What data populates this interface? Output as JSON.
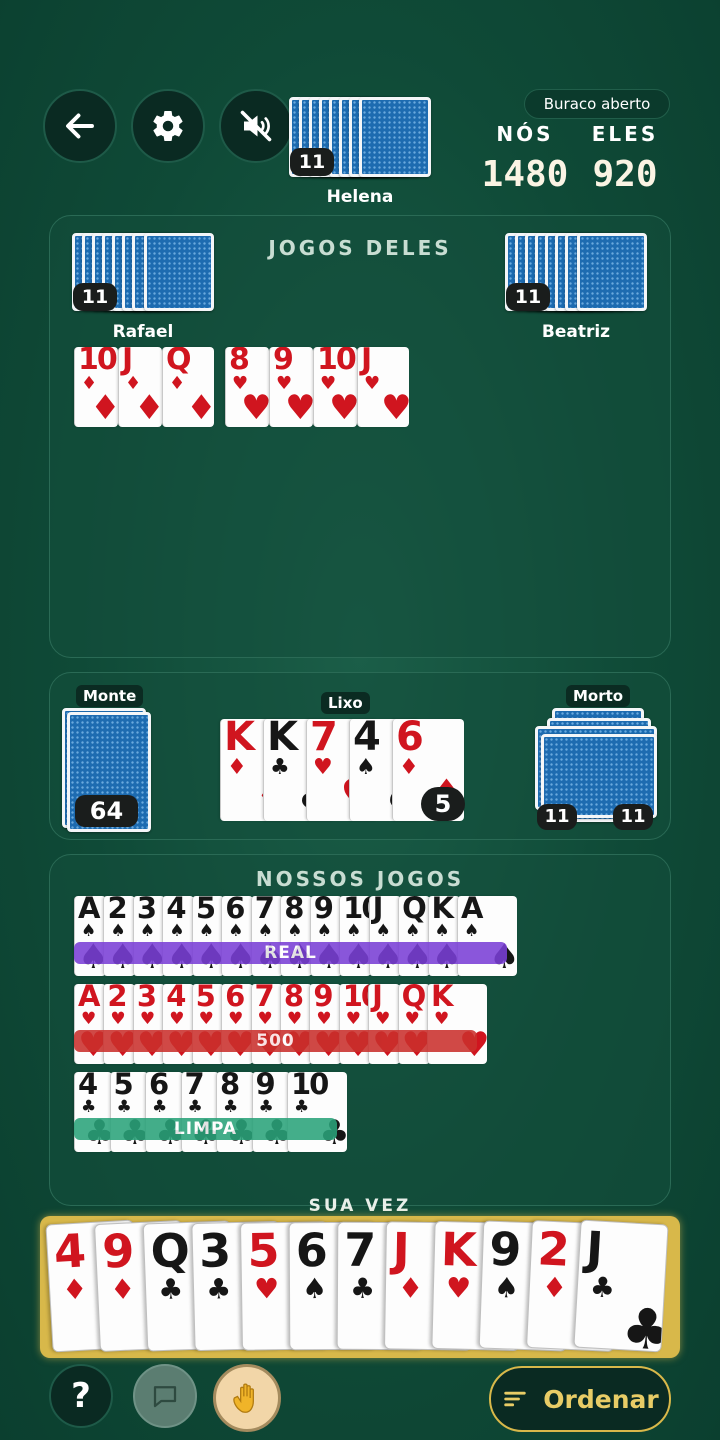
{
  "top": {
    "back_icon": "arrow-left-icon",
    "settings_icon": "gear-icon",
    "sound_icon": "speaker-muted-icon",
    "opponent_top": {
      "name": "Helena",
      "count": "11"
    }
  },
  "score": {
    "mode": "Buraco aberto",
    "us_label": "NÓS",
    "them_label": "ELES",
    "us_value": "1480",
    "them_value": "920"
  },
  "their_games": {
    "title": "JOGOS DELES",
    "left_player": {
      "name": "Rafael",
      "count": "11"
    },
    "right_player": {
      "name": "Beatriz",
      "count": "11"
    },
    "melds": [
      {
        "cards": [
          {
            "r": "10",
            "s": "♦",
            "c": "red"
          },
          {
            "r": "J",
            "s": "♦",
            "c": "red"
          },
          {
            "r": "Q",
            "s": "♦",
            "c": "red"
          }
        ]
      },
      {
        "cards": [
          {
            "r": "8",
            "s": "♥",
            "c": "red"
          },
          {
            "r": "9",
            "s": "♥",
            "c": "red"
          },
          {
            "r": "10",
            "s": "♥",
            "c": "red"
          },
          {
            "r": "J",
            "s": "♥",
            "c": "red"
          }
        ]
      }
    ]
  },
  "table": {
    "stock_label": "Monte",
    "stock_count": "64",
    "discard_label": "Lixo",
    "discard_count": "5",
    "discard_cards": [
      {
        "r": "K",
        "s": "♦",
        "c": "red"
      },
      {
        "r": "K",
        "s": "♣",
        "c": "blk"
      },
      {
        "r": "7",
        "s": "♥",
        "c": "red"
      },
      {
        "r": "4",
        "s": "♠",
        "c": "blk"
      },
      {
        "r": "6",
        "s": "♦",
        "c": "red"
      }
    ],
    "dead_label": "Morto",
    "dead_counts": [
      "11",
      "11"
    ]
  },
  "our_games": {
    "title": "NOSSOS JOGOS",
    "melds": [
      {
        "label": "REAL",
        "band_color": "#7a3fd6",
        "cards": [
          {
            "r": "A",
            "s": "♠",
            "c": "blk"
          },
          {
            "r": "2",
            "s": "♠",
            "c": "blk"
          },
          {
            "r": "3",
            "s": "♠",
            "c": "blk"
          },
          {
            "r": "4",
            "s": "♠",
            "c": "blk"
          },
          {
            "r": "5",
            "s": "♠",
            "c": "blk"
          },
          {
            "r": "6",
            "s": "♠",
            "c": "blk"
          },
          {
            "r": "7",
            "s": "♠",
            "c": "blk"
          },
          {
            "r": "8",
            "s": "♠",
            "c": "blk"
          },
          {
            "r": "9",
            "s": "♠",
            "c": "blk"
          },
          {
            "r": "10",
            "s": "♠",
            "c": "blk"
          },
          {
            "r": "J",
            "s": "♠",
            "c": "blk"
          },
          {
            "r": "Q",
            "s": "♠",
            "c": "blk"
          },
          {
            "r": "K",
            "s": "♠",
            "c": "blk"
          },
          {
            "r": "A",
            "s": "♠",
            "c": "blk"
          }
        ]
      },
      {
        "label": "500",
        "band_color": "#c9302c",
        "cards": [
          {
            "r": "A",
            "s": "♥",
            "c": "red"
          },
          {
            "r": "2",
            "s": "♥",
            "c": "red"
          },
          {
            "r": "3",
            "s": "♥",
            "c": "red"
          },
          {
            "r": "4",
            "s": "♥",
            "c": "red"
          },
          {
            "r": "5",
            "s": "♥",
            "c": "red"
          },
          {
            "r": "6",
            "s": "♥",
            "c": "red"
          },
          {
            "r": "7",
            "s": "♥",
            "c": "red"
          },
          {
            "r": "8",
            "s": "♥",
            "c": "red"
          },
          {
            "r": "9",
            "s": "♥",
            "c": "red"
          },
          {
            "r": "10",
            "s": "♥",
            "c": "red"
          },
          {
            "r": "J",
            "s": "♥",
            "c": "red"
          },
          {
            "r": "Q",
            "s": "♥",
            "c": "red"
          },
          {
            "r": "K",
            "s": "♥",
            "c": "red"
          }
        ]
      },
      {
        "label": "LIMPA",
        "band_color": "#2aa37a",
        "cards": [
          {
            "r": "4",
            "s": "♣",
            "c": "blk"
          },
          {
            "r": "5",
            "s": "♣",
            "c": "blk"
          },
          {
            "r": "6",
            "s": "♣",
            "c": "blk"
          },
          {
            "r": "7",
            "s": "♣",
            "c": "blk"
          },
          {
            "r": "8",
            "s": "♣",
            "c": "blk"
          },
          {
            "r": "9",
            "s": "♣",
            "c": "blk"
          },
          {
            "r": "10",
            "s": "♣",
            "c": "blk"
          }
        ]
      }
    ]
  },
  "hand": {
    "turn_label": "SUA VEZ",
    "cards": [
      {
        "r": "4",
        "s": "♦",
        "c": "red"
      },
      {
        "r": "9",
        "s": "♦",
        "c": "red"
      },
      {
        "r": "Q",
        "s": "♣",
        "c": "blk"
      },
      {
        "r": "3",
        "s": "♣",
        "c": "blk"
      },
      {
        "r": "5",
        "s": "♥",
        "c": "red"
      },
      {
        "r": "6",
        "s": "♠",
        "c": "blk"
      },
      {
        "r": "7",
        "s": "♣",
        "c": "blk"
      },
      {
        "r": "J",
        "s": "♦",
        "c": "red"
      },
      {
        "r": "K",
        "s": "♥",
        "c": "red"
      },
      {
        "r": "9",
        "s": "♠",
        "c": "blk"
      },
      {
        "r": "2",
        "s": "♦",
        "c": "red"
      },
      {
        "r": "J",
        "s": "♣",
        "c": "blk"
      }
    ]
  },
  "bottom": {
    "help_label": "?",
    "chat_icon": "chat-bubble-icon",
    "wave_icon": "waving-hand-icon",
    "sort_label": "Ordenar",
    "sort_icon": "sort-lines-icon"
  },
  "colors": {
    "felt": "#0f4a37",
    "accent_gold": "#d8b84a",
    "card_red": "#d0151f"
  }
}
